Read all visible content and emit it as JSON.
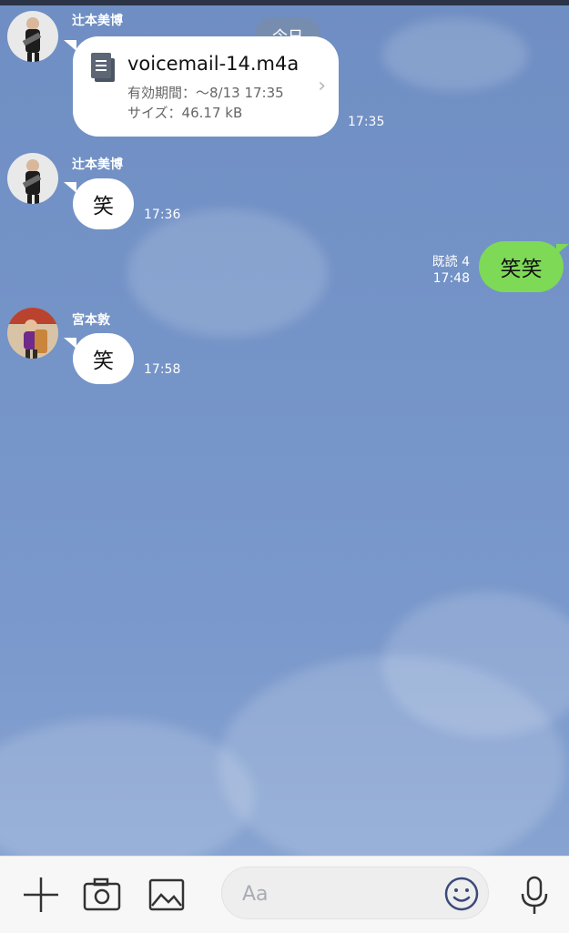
{
  "date_separator": "今日",
  "messages": [
    {
      "sender": "辻本美博",
      "type": "file",
      "file_name": "voicemail-14.m4a",
      "expiry": "有効期間：〜8/13 17:35",
      "size": "サイズ：46.17 kB",
      "time": "17:35"
    },
    {
      "sender": "辻本美博",
      "type": "text",
      "text": "笑",
      "time": "17:36"
    },
    {
      "sender": "me",
      "type": "text",
      "text": "笑笑",
      "read": "既読 4",
      "time": "17:48"
    },
    {
      "sender": "宮本敦",
      "type": "text",
      "text": "笑",
      "time": "17:58"
    }
  ],
  "input": {
    "placeholder": "Aa",
    "value": ""
  },
  "toolbar": {
    "plus_icon": "plus-icon",
    "camera_icon": "camera-icon",
    "image_icon": "image-icon",
    "emoji_icon": "emoji-icon",
    "mic_icon": "microphone-icon"
  },
  "colors": {
    "chat_background": "#7594c8",
    "my_bubble": "#7ed957",
    "their_bubble": "#ffffff",
    "input_bar": "#f7f7f7"
  }
}
